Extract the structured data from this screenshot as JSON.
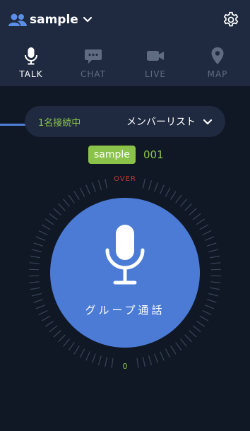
{
  "header": {
    "group_name": "sample",
    "icons": {
      "group": "group-icon",
      "dropdown": "chevron-down-icon",
      "settings": "gear-icon"
    }
  },
  "tabs": [
    {
      "label": "TALK",
      "icon": "microphone-icon",
      "active": true
    },
    {
      "label": "CHAT",
      "icon": "chat-bubble-icon",
      "active": false
    },
    {
      "label": "LIVE",
      "icon": "video-camera-icon",
      "active": false
    },
    {
      "label": "MAP",
      "icon": "map-pin-icon",
      "active": false
    }
  ],
  "members": {
    "connected_count": "1名接続中",
    "list_label": "メンバーリスト"
  },
  "current_user": {
    "name": "sample",
    "id": "001"
  },
  "talk": {
    "over_label": "OVER",
    "button_label": "グループ通話",
    "level": "0"
  },
  "colors": {
    "background": "#101826",
    "header": "#1f2a40",
    "accent": "#4c7bd6",
    "green": "#8bc34a",
    "over_red": "#c0392b"
  }
}
